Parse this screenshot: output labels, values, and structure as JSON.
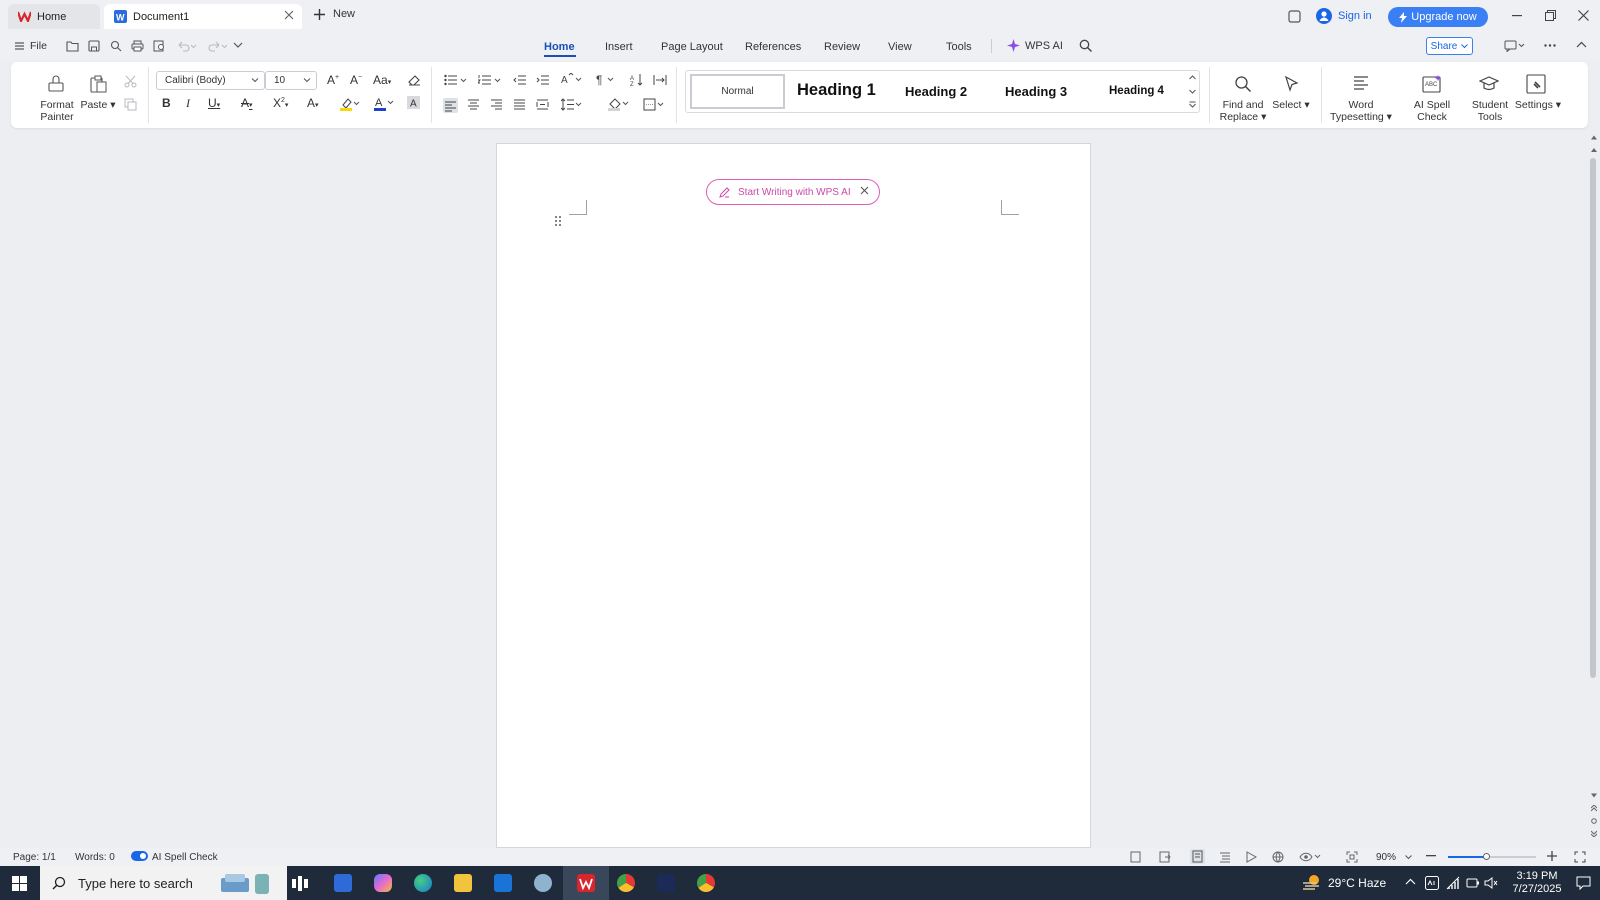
{
  "titlebar": {
    "tabs": [
      {
        "label": "Home"
      },
      {
        "label": "Document1"
      }
    ],
    "new_label": "New",
    "signin_label": "Sign in",
    "upgrade_label": "Upgrade now"
  },
  "menubar": {
    "file_label": "File",
    "tabs": [
      "Home",
      "Insert",
      "Page Layout",
      "References",
      "Review",
      "View",
      "Tools"
    ],
    "wps_ai_label": "WPS AI",
    "share_label": "Share"
  },
  "ribbon": {
    "format_painter": "Format Painter",
    "paste": "Paste",
    "font_name": "Calibri (Body)",
    "font_size": "10",
    "styles": [
      "Normal",
      "Heading 1",
      "Heading 2",
      "Heading 3",
      "Heading 4"
    ],
    "find_replace": "Find and Replace",
    "select": "Select",
    "word_typesetting": "Word Typesetting",
    "ai_spell_check": "AI Spell Check",
    "student_tools": "Student Tools",
    "settings": "Settings"
  },
  "document": {
    "ai_prompt": "Start Writing with WPS AI"
  },
  "statusbar": {
    "page": "Page: 1/1",
    "words": "Words: 0",
    "spell_check": "AI Spell Check",
    "zoom": "90%",
    "zoom_fraction": 0.44
  },
  "taskbar": {
    "search_placeholder": "Type here to search",
    "weather": "29°C  Haze",
    "time": "3:19 PM",
    "date": "7/27/2025"
  },
  "colors": {
    "accent": "#1a66e8",
    "upgrade": "#3a7ff3",
    "ai_pink": "#e05dbb",
    "taskbar": "#1f2a3a"
  }
}
